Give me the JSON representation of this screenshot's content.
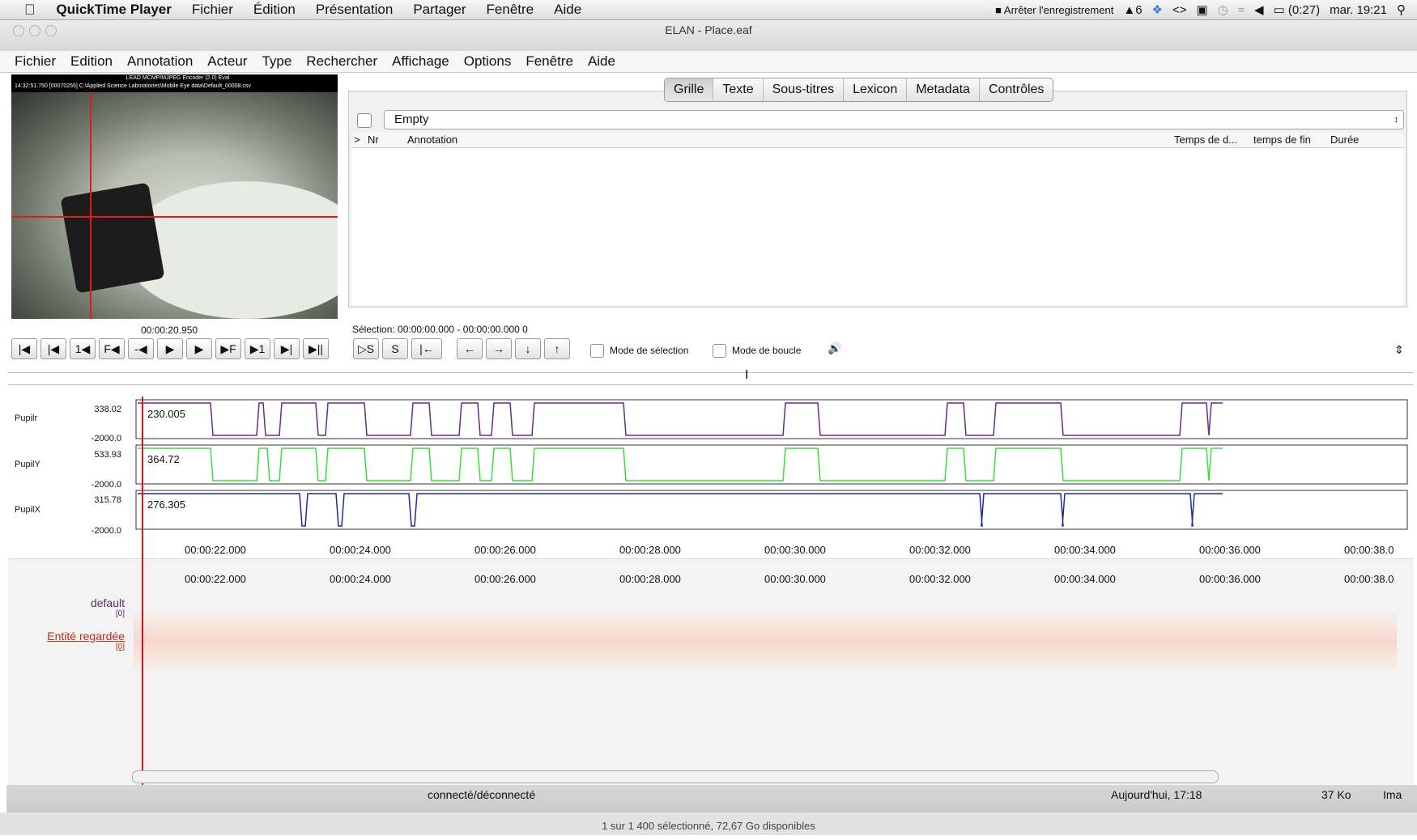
{
  "macbar": {
    "app_name": "QuickTime Player",
    "menus": [
      "Fichier",
      "Édition",
      "Présentation",
      "Partager",
      "Fenêtre",
      "Aide"
    ],
    "status_record": "Arrêter l'enregistrement",
    "status_count": "6",
    "status_battery": "(0:27)",
    "status_clock": "mar. 19:21"
  },
  "window": {
    "title": "ELAN - Place.eaf"
  },
  "app_menu": [
    "Fichier",
    "Edition",
    "Annotation",
    "Acteur",
    "Type",
    "Rechercher",
    "Affichage",
    "Options",
    "Fenêtre",
    "Aide"
  ],
  "video": {
    "header_line1": "LEAD MCMP/MJPEG Encoder (2.0) Eval",
    "header_line2": "14:32:51.750  [00070255]  C:\\Applied Science Laboratories\\Mobile Eye data\\Default_00008.csv",
    "time": "00:00:20.950"
  },
  "tabs": [
    {
      "label": "Grille",
      "selected": true
    },
    {
      "label": "Texte",
      "selected": false
    },
    {
      "label": "Sous-titres",
      "selected": false
    },
    {
      "label": "Lexicon",
      "selected": false
    },
    {
      "label": "Metadata",
      "selected": false
    },
    {
      "label": "Contrôles",
      "selected": false
    }
  ],
  "grid": {
    "tier_select": "Empty",
    "headers": {
      "nr": "Nr",
      "annotation": "Annotation",
      "start": "Temps de d...",
      "end": "temps de fin",
      "duration": "Durée"
    }
  },
  "selection": "Sélection: 00:00:00.000 - 00:00:00.000  0",
  "controls": {
    "mode_selection": "Mode de sélection",
    "mode_boucle": "Mode de boucle"
  },
  "tracks": [
    {
      "name": "Pupilr",
      "max": "338.02",
      "min": "-2000.0",
      "value": "230.005",
      "color": "#6a2a8a"
    },
    {
      "name": "PupilY",
      "max": "533.93",
      "min": "-2000.0",
      "value": "364.72",
      "color": "#3ddb3d"
    },
    {
      "name": "PupilX",
      "max": "315.78",
      "min": "-2000.0",
      "value": "276.305",
      "color": "#1c28a8"
    }
  ],
  "time_ticks": [
    "00:00:22.000",
    "00:00:24.000",
    "00:00:26.000",
    "00:00:28.000",
    "00:00:30.000",
    "00:00:32.000",
    "00:00:34.000",
    "00:00:36.000",
    "00:00:38.0"
  ],
  "tiers": [
    {
      "name": "default",
      "count": "[0]"
    },
    {
      "name": "Entité regardée",
      "count": "[0]"
    }
  ],
  "finder": {
    "connect": "connecté/déconnecté",
    "date": "Aujourd'hui, 17:18",
    "size": "37 Ko",
    "kind": "Ima",
    "status": "1 sur 1 400 sélectionné, 72,67 Go disponibles"
  }
}
